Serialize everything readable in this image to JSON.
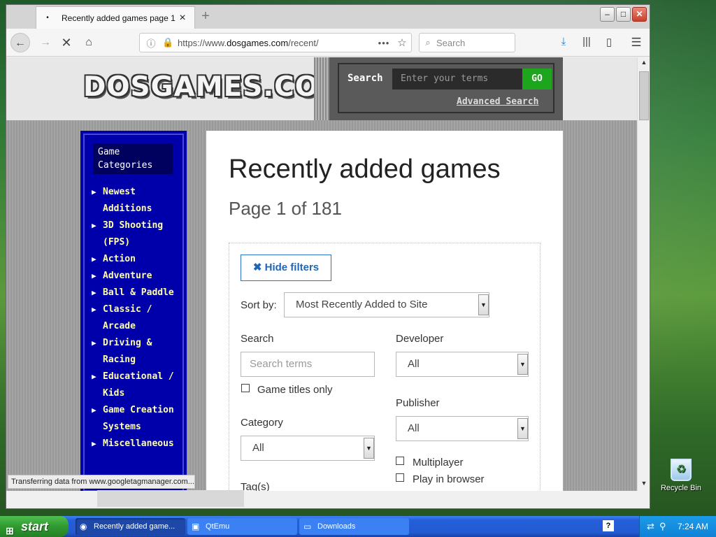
{
  "browser": {
    "tab_title": "Recently added games page 1",
    "url_prefix": "https://www.",
    "url_domain": "dosgames.com",
    "url_path": "/recent/",
    "search_placeholder": "Search",
    "status_text": "Transferring data from www.googletagmanager.com..."
  },
  "site": {
    "logo": "DOSGAMES.COM",
    "search_label": "Search",
    "search_placeholder": "Enter your terms",
    "go_label": "GO",
    "advanced_search": "Advanced Search"
  },
  "sidebar": {
    "heading": "Game Categories",
    "items": [
      {
        "label": "Newest Additions"
      },
      {
        "label": "3D Shooting (FPS)"
      },
      {
        "label": "Action"
      },
      {
        "label": "Adventure"
      },
      {
        "label": "Ball & Paddle"
      },
      {
        "label": "Classic / Arcade"
      },
      {
        "label": "Driving & Racing"
      },
      {
        "label": "Educational / Kids"
      },
      {
        "label": "Game Creation Systems"
      },
      {
        "label": "Miscellaneous"
      }
    ]
  },
  "main": {
    "title": "Recently added games",
    "subtitle": "Page 1 of 181",
    "hide_filters": "Hide filters",
    "sort_label": "Sort by:",
    "sort_value": "Most Recently Added to Site",
    "search_label": "Search",
    "search_placeholder": "Search terms",
    "titles_only": "Game titles only",
    "category_label": "Category",
    "category_value": "All",
    "tags_label": "Tag(s)",
    "developer_label": "Developer",
    "developer_value": "All",
    "publisher_label": "Publisher",
    "publisher_value": "All",
    "multiplayer": "Multiplayer",
    "play_in_browser": "Play in browser"
  },
  "desktop": {
    "recycle_bin": "Recycle Bin"
  },
  "taskbar": {
    "start": "start",
    "tasks": [
      {
        "label": "Recently added game..."
      },
      {
        "label": "QtEmu"
      },
      {
        "label": "Downloads"
      }
    ],
    "clock": "7:24 AM"
  }
}
